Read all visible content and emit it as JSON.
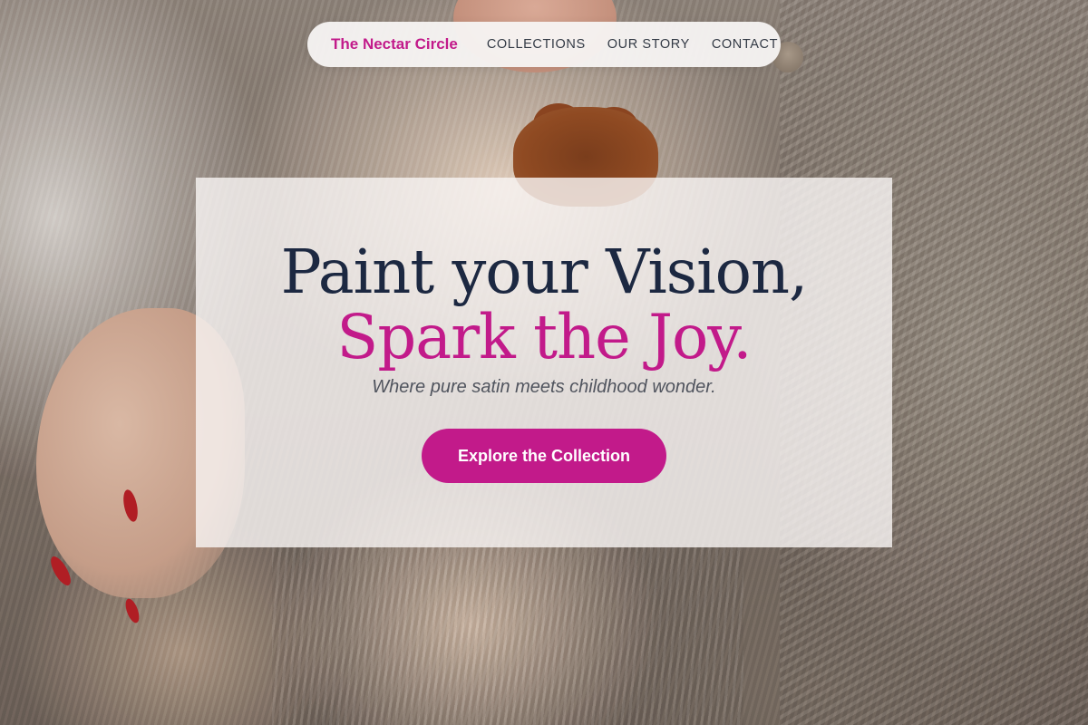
{
  "header": {
    "brand": "The Nectar Circle",
    "nav_items": [
      {
        "label": "COLLECTIONS"
      },
      {
        "label": "OUR STORY"
      },
      {
        "label": "CONTACT"
      }
    ]
  },
  "hero": {
    "headline_line_1": "Paint your Vision,",
    "headline_line_2": "Spark the Joy.",
    "tagline": "Where pure satin meets childhood wonder.",
    "cta_label": "Explore the Collection",
    "background_image": "baby-in-knit-outfit-photo"
  },
  "colors": {
    "accent": "#c21a8a",
    "headline": "#1c2841",
    "nav_text": "#333a45",
    "tagline": "#50545e",
    "card_background": "#f8f4f3"
  }
}
